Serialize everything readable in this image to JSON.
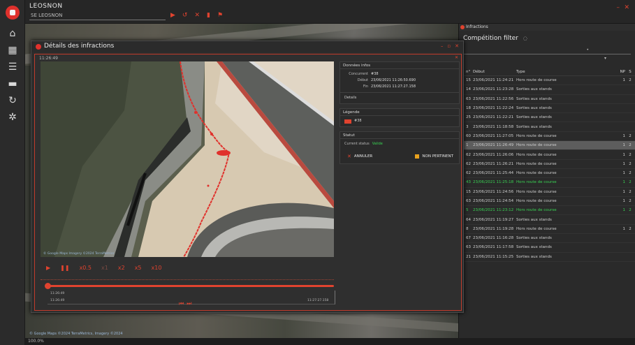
{
  "app": {
    "title": "LEOSNON",
    "layer_select": "SE LEOSNON"
  },
  "topbar_icons": [
    "play-icon",
    "history-icon",
    "close-icon",
    "delete-icon",
    "flag-icon"
  ],
  "sidebar": {
    "items": [
      {
        "icon": "home-icon",
        "glyph": "⌂"
      },
      {
        "icon": "dashboard-icon",
        "glyph": "▦"
      },
      {
        "icon": "list-icon",
        "glyph": "☰"
      },
      {
        "icon": "chat-icon",
        "glyph": "▬"
      },
      {
        "icon": "refresh-icon",
        "glyph": "↻"
      },
      {
        "icon": "settings-icon",
        "glyph": "✲"
      }
    ]
  },
  "status_bar": "100.0%",
  "bgmap_attrib": "© Google Maps ©2024 TerraMetrics, Imagery ©2024",
  "infractions_panel": {
    "header": "Infractions",
    "filter_title": "Compétition filter",
    "filter_value1": "•",
    "filter_value2": "▾",
    "columns": {
      "n": "n°",
      "date": "Début",
      "type": "Type",
      "np": "NP",
      "s": "S"
    },
    "rows": [
      {
        "n": "15",
        "date": "23/06/2021 11:24:21",
        "type": "Hors route de course",
        "np": "1",
        "s": "2",
        "state": ""
      },
      {
        "n": "14",
        "date": "23/06/2021 11:23:28",
        "type": "Sorties aux stands",
        "np": "",
        "s": "",
        "state": ""
      },
      {
        "n": "63",
        "date": "23/06/2021 11:22:56",
        "type": "Sorties aux stands",
        "np": "",
        "s": "",
        "state": ""
      },
      {
        "n": "18",
        "date": "23/06/2021 11:22:24",
        "type": "Sorties aux stands",
        "np": "",
        "s": "",
        "state": ""
      },
      {
        "n": "25",
        "date": "23/06/2021 11:22:21",
        "type": "Sorties aux stands",
        "np": "",
        "s": "",
        "state": ""
      },
      {
        "n": "3",
        "date": "23/06/2021 11:18:58",
        "type": "Sorties aux stands",
        "np": "",
        "s": "",
        "state": ""
      },
      {
        "n": "60",
        "date": "23/06/2021 11:27:05",
        "type": "Hors route de course",
        "np": "1",
        "s": "2",
        "state": ""
      },
      {
        "n": "1",
        "date": "23/06/2021 11:26:49",
        "type": "Hors route de course",
        "np": "1",
        "s": "2",
        "state": "sel"
      },
      {
        "n": "62",
        "date": "23/06/2021 11:26:06",
        "type": "Hors route de course",
        "np": "1",
        "s": "2",
        "state": ""
      },
      {
        "n": "62",
        "date": "23/06/2021 11:26:21",
        "type": "Hors route de course",
        "np": "1",
        "s": "2",
        "state": ""
      },
      {
        "n": "62",
        "date": "23/06/2021 11:25:44",
        "type": "Hors route de course",
        "np": "1",
        "s": "2",
        "state": ""
      },
      {
        "n": "43",
        "date": "23/06/2021 11:25:18",
        "type": "Hors route de course",
        "np": "1",
        "s": "2",
        "state": "green"
      },
      {
        "n": "15",
        "date": "23/06/2021 11:24:56",
        "type": "Hors route de course",
        "np": "1",
        "s": "2",
        "state": ""
      },
      {
        "n": "63",
        "date": "23/06/2021 11:24:54",
        "type": "Hors route de course",
        "np": "1",
        "s": "2",
        "state": ""
      },
      {
        "n": "5",
        "date": "23/06/2021 11:23:12",
        "type": "Hors route de course",
        "np": "1",
        "s": "2",
        "state": "green"
      },
      {
        "n": "64",
        "date": "23/06/2021 11:19:27",
        "type": "Sorties aux stands",
        "np": "",
        "s": "",
        "state": ""
      },
      {
        "n": "8",
        "date": "23/06/2021 11:19:28",
        "type": "Hors route de course",
        "np": "1",
        "s": "2",
        "state": ""
      },
      {
        "n": "67",
        "date": "23/06/2021 11:16:28",
        "type": "Sorties aux stands",
        "np": "",
        "s": "",
        "state": ""
      },
      {
        "n": "63",
        "date": "23/06/2021 11:17:58",
        "type": "Sorties aux stands",
        "np": "",
        "s": "",
        "state": ""
      },
      {
        "n": "21",
        "date": "23/06/2021 11:15:25",
        "type": "Sorties aux stands",
        "np": "",
        "s": "",
        "state": ""
      }
    ]
  },
  "dialog": {
    "title": "Détails des infractions",
    "time_label": "11:26:49",
    "video_attrib": "© Google Maps Imagery ©2024 TerraMetrics",
    "controls": [
      "▶",
      "❚❚",
      "x0.5",
      "x1",
      "x2",
      "x5",
      "x10"
    ],
    "timeline": {
      "start_label_1": "11:26:49",
      "start_label_2": "11:26:49",
      "end_label": "11:27:27.158",
      "nav_prev": "⏮",
      "nav_next": "⏭"
    },
    "general_data": {
      "header": "Données infos",
      "k1": "Concurrent",
      "v1": "#38",
      "k2": "Début",
      "v2": "23/06/2021 11:26:50.690",
      "k3": "Fin",
      "v3": "23/06/2021 11:27:27.158",
      "details": "Details"
    },
    "legend": {
      "header": "Légende",
      "item": "#38"
    },
    "status": {
      "header": "Statut",
      "label": "Current status",
      "value": "Valide",
      "cancel_label": "ANNULER",
      "not_relevant_label": "NON PERTINENT"
    }
  },
  "colors": {
    "accent": "#e0432f",
    "valid": "#39d353",
    "flag": "#e8a21e"
  }
}
